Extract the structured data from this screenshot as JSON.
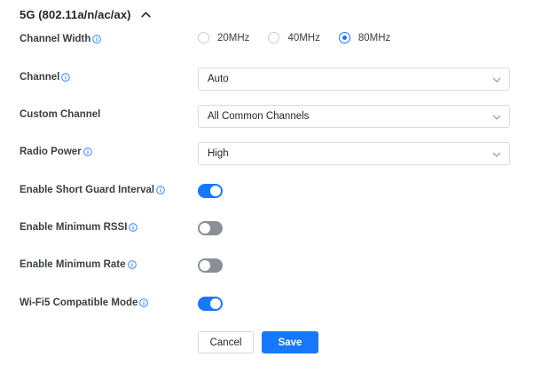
{
  "section": {
    "title": "5G (802.11a/n/ac/ax)",
    "expanded": true
  },
  "channel_width": {
    "label": "Channel Width",
    "options": [
      "20MHz",
      "40MHz",
      "80MHz"
    ],
    "selected": "80MHz"
  },
  "channel": {
    "label": "Channel",
    "value": "Auto"
  },
  "custom_channel": {
    "label": "Custom Channel",
    "value": "All Common Channels"
  },
  "radio_power": {
    "label": "Radio Power",
    "value": "High"
  },
  "short_guard_interval": {
    "label": "Enable Short Guard Interval",
    "enabled": true
  },
  "minimum_rssi": {
    "label": "Enable Minimum RSSI",
    "enabled": false
  },
  "minimum_rate": {
    "label": "Enable Minimum Rate",
    "enabled": false
  },
  "wifi5_compatible": {
    "label": "Wi-Fi5 Compatible Mode",
    "enabled": true
  },
  "actions": {
    "cancel": "Cancel",
    "save": "Save"
  },
  "colors": {
    "accent": "#1677ff",
    "toggle_off": "#8a8f97",
    "label": "#3b3f45"
  }
}
